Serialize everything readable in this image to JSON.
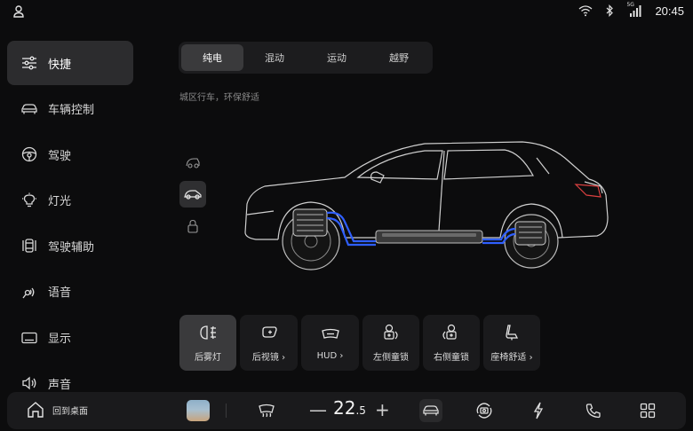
{
  "status": {
    "time": "20:45",
    "signal_label": "5G"
  },
  "sidebar": {
    "items": [
      {
        "label": "快捷",
        "icon": "sliders-icon",
        "active": true
      },
      {
        "label": "车辆控制",
        "icon": "car-icon"
      },
      {
        "label": "驾驶",
        "icon": "steering-wheel-icon"
      },
      {
        "label": "灯光",
        "icon": "light-icon"
      },
      {
        "label": "驾驶辅助",
        "icon": "driver-assist-icon"
      },
      {
        "label": "语音",
        "icon": "voice-icon"
      },
      {
        "label": "显示",
        "icon": "display-icon"
      },
      {
        "label": "声音",
        "icon": "speaker-icon"
      }
    ]
  },
  "modes": {
    "tabs": [
      "纯电",
      "混动",
      "运动",
      "越野"
    ],
    "active": 0,
    "description": "城区行车，环保舒适"
  },
  "views": {
    "items": [
      "side-view-icon",
      "front-view-icon",
      "lock-view-icon"
    ],
    "active": 1
  },
  "controls": {
    "items": [
      {
        "label": "后雾灯",
        "icon": "rear-fog-light-icon",
        "active": true
      },
      {
        "label": "后视镜",
        "icon": "mirror-icon",
        "chevron": true
      },
      {
        "label": "HUD",
        "icon": "hud-icon",
        "chevron": true
      },
      {
        "label": "左侧童锁",
        "icon": "left-child-lock-icon"
      },
      {
        "label": "右侧童锁",
        "icon": "right-child-lock-icon"
      },
      {
        "label": "座椅舒适",
        "icon": "seat-icon",
        "chevron": true
      }
    ]
  },
  "dock": {
    "home_label": "回到桌面",
    "temperature_int": "22",
    "temperature_dec": ".5",
    "minus": "—",
    "plus": "+"
  },
  "colors": {
    "accent_blue": "#2f5fff",
    "active_bg": "#3a3a3c"
  }
}
